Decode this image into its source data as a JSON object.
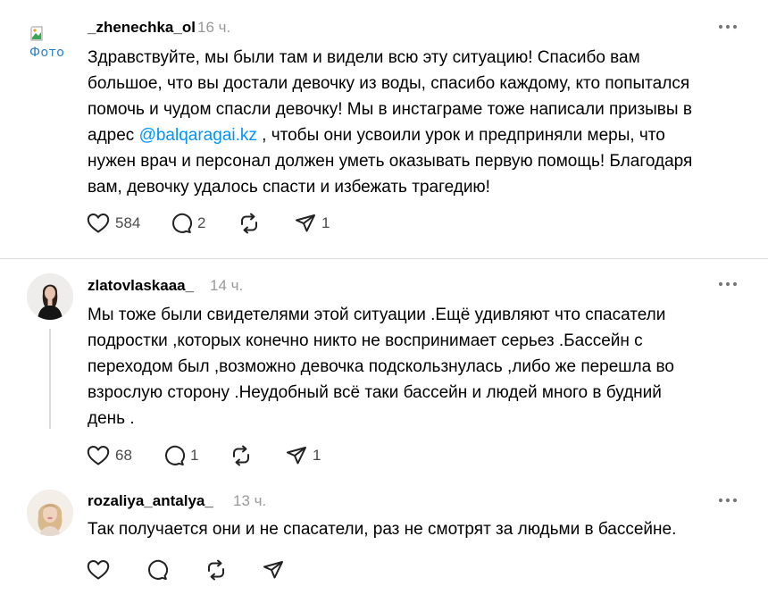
{
  "posts": [
    {
      "username": "_zhenechka_ol",
      "time": "16 ч.",
      "avatar_alt": "Фото",
      "lines": [
        "Здравствуйте, мы были там и видели всю эту ситуацию! Спасибо вам",
        "большое, что вы достали девочку из воды, спасибо каждому, кто попытался",
        "помочь и чудом спасли девочку! Мы в инстаграме тоже написали призывы в"
      ],
      "line4_before": "адрес ",
      "mention": "@balqaragai.kz",
      "line4_after": " , чтобы они усвоили урок и предприняли меры, что",
      "lines_end": [
        "нужен врач и персонал должен уметь оказывать первую помощь! Благодаря",
        "вам, девочку удалось спасти и избежать трагедию!"
      ],
      "likes": "584",
      "comments": "2",
      "shares": "1"
    },
    {
      "username": "zlatovlaskaaa_",
      "time": "14 ч.",
      "lines": [
        "Мы тоже были свидетелями этой ситуации .Ещё удивляют что спасатели",
        "подростки ,которых конечно никто не воспринимает серьез .Бассейн с",
        "переходом был ,возможно девочка подскользнулась ,либо же перешла во",
        "взрослую сторону .Неудобный всё таки бассейн и людей много в будний",
        "день ."
      ],
      "likes": "68",
      "comments": "1",
      "shares": "1"
    },
    {
      "username": "rozaliya_antalya_",
      "time": "13 ч.",
      "lines": [
        "Так получается они и не спасатели, раз не смотрят за людьми в бассейне."
      ]
    }
  ],
  "icons": {
    "like": "heart-icon",
    "comment": "comment-icon",
    "repost": "repost-icon",
    "share": "share-icon",
    "more": "more-icon"
  },
  "colors": {
    "mention": "#0095f6",
    "muted": "#999999",
    "divider": "#dcdcdc"
  }
}
